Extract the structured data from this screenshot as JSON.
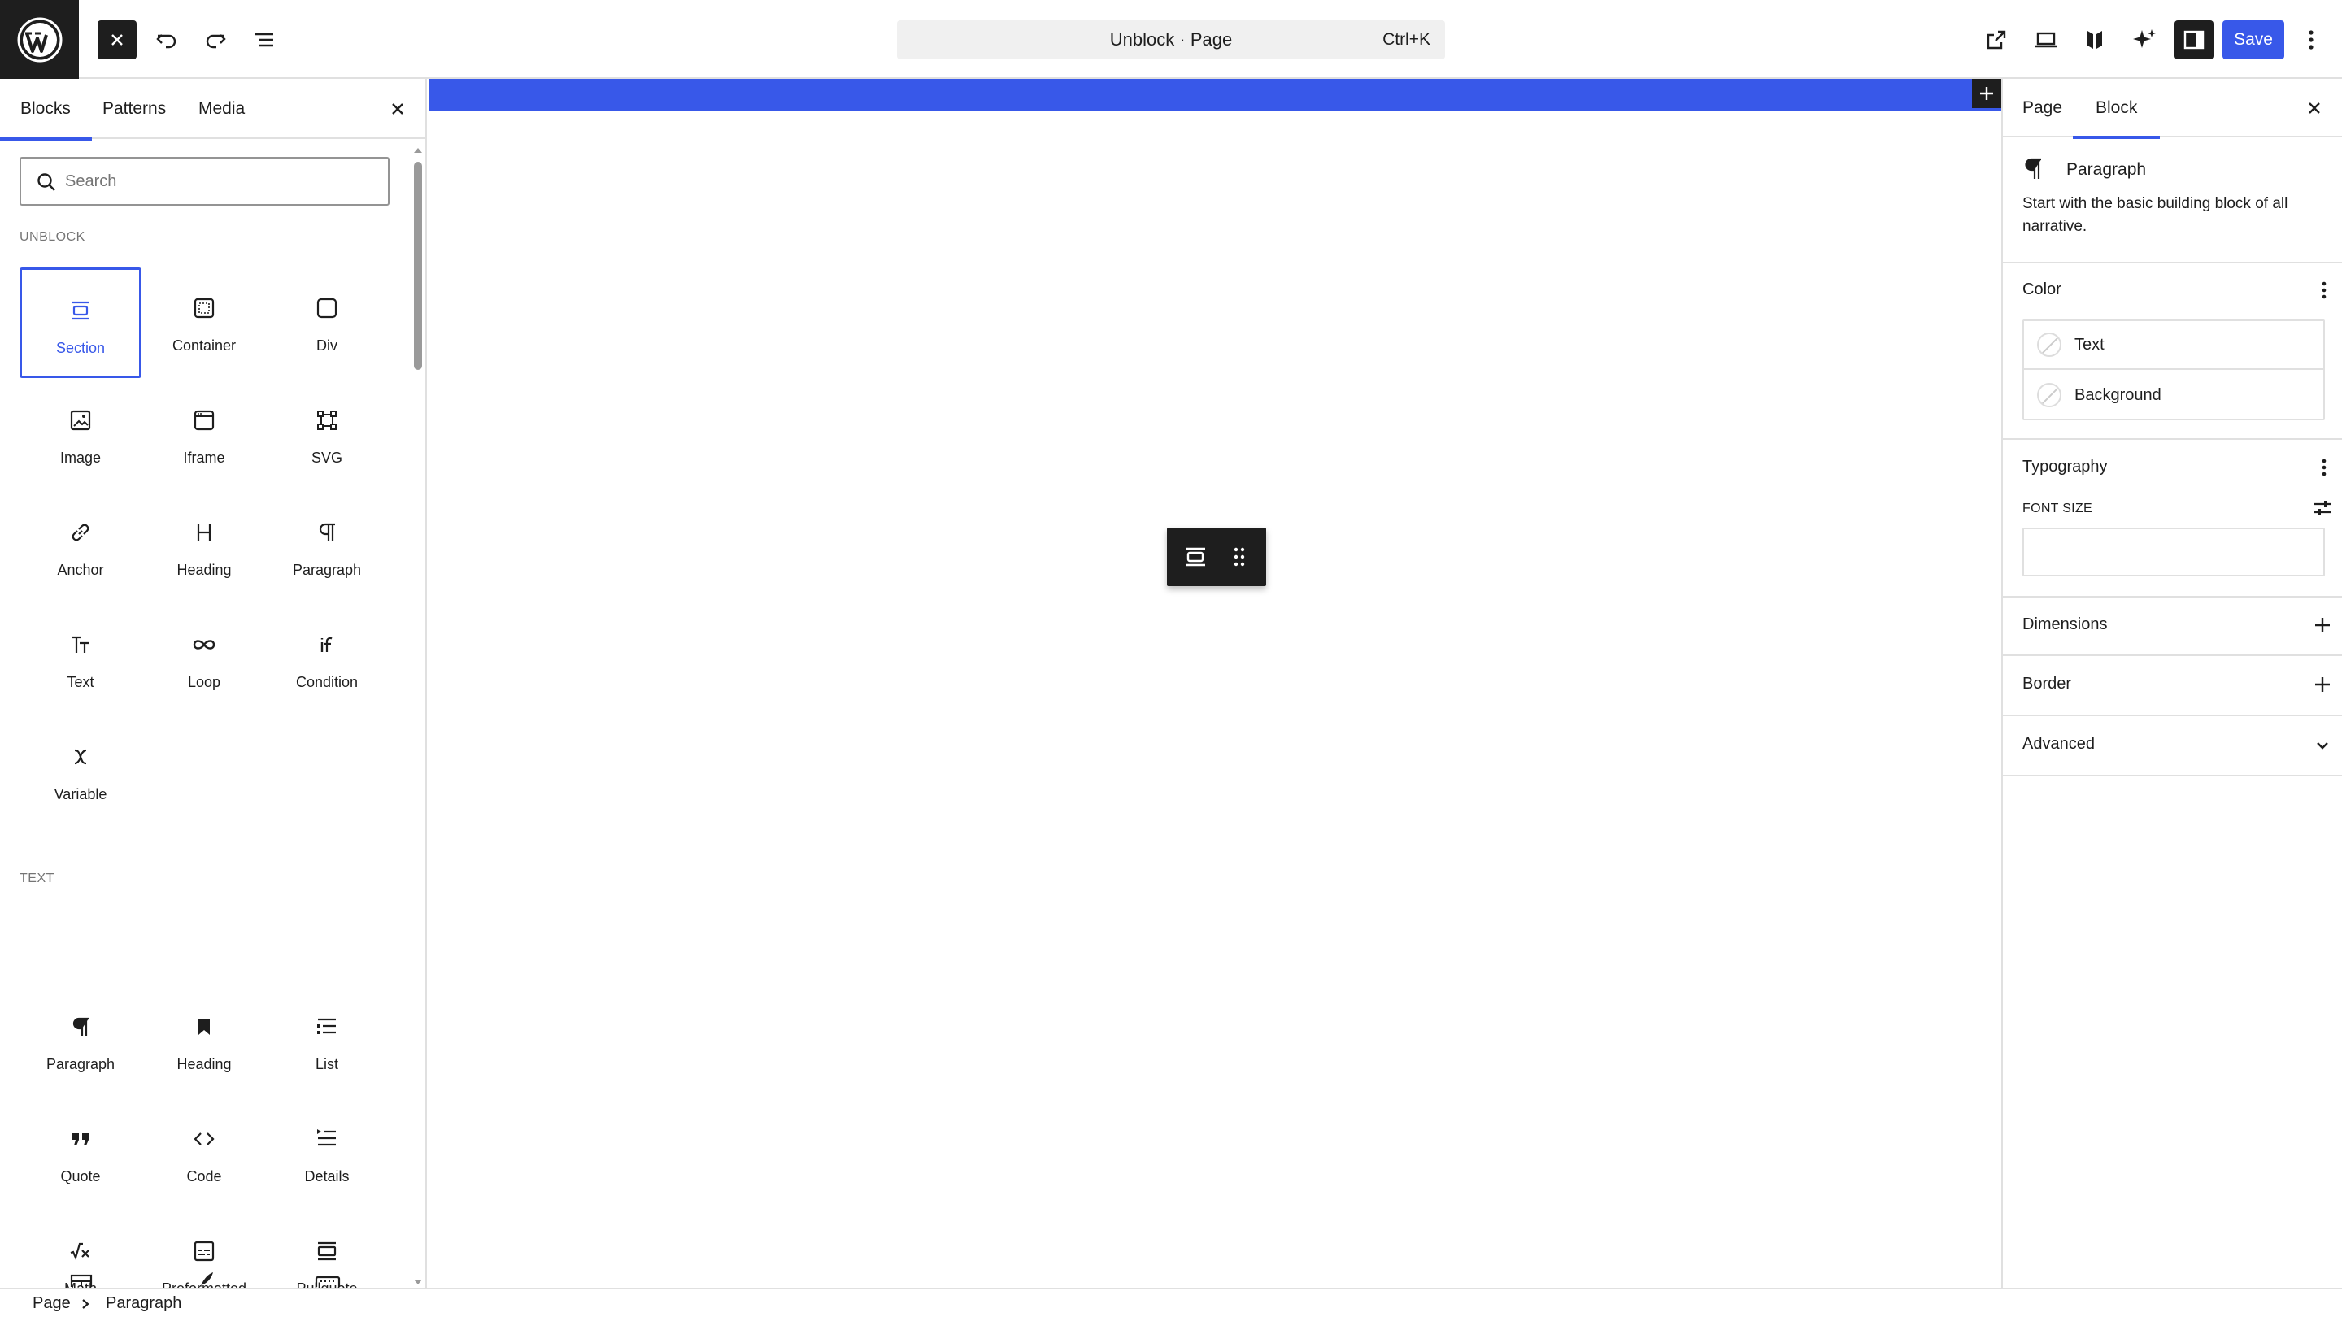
{
  "topbar": {
    "document_title": "Unblock · Page",
    "shortcut": "Ctrl+K",
    "save_label": "Save"
  },
  "left_panel": {
    "tabs": [
      {
        "label": "Blocks",
        "active": true
      },
      {
        "label": "Patterns",
        "active": false
      },
      {
        "label": "Media",
        "active": false
      }
    ],
    "search_placeholder": "Search",
    "categories": [
      {
        "label": "UNBLOCK",
        "blocks": [
          {
            "label": "Section",
            "icon": "section-icon",
            "selected": true
          },
          {
            "label": "Container",
            "icon": "container-icon"
          },
          {
            "label": "Div",
            "icon": "div-icon"
          },
          {
            "label": "Image",
            "icon": "image-icon"
          },
          {
            "label": "Iframe",
            "icon": "iframe-icon"
          },
          {
            "label": "SVG",
            "icon": "svg-icon"
          },
          {
            "label": "Anchor",
            "icon": "link-icon"
          },
          {
            "label": "Heading",
            "icon": "heading-icon"
          },
          {
            "label": "Paragraph",
            "icon": "paragraph-icon"
          },
          {
            "label": "Text",
            "icon": "text-icon"
          },
          {
            "label": "Loop",
            "icon": "loop-icon"
          },
          {
            "label": "Condition",
            "icon": "condition-icon"
          },
          {
            "label": "Variable",
            "icon": "variable-icon"
          }
        ]
      },
      {
        "label": "TEXT",
        "blocks": [
          {
            "label": "Paragraph",
            "icon": "paragraph-icon"
          },
          {
            "label": "Heading",
            "icon": "bookmark-icon"
          },
          {
            "label": "List",
            "icon": "list-icon"
          },
          {
            "label": "Quote",
            "icon": "quote-icon"
          },
          {
            "label": "Code",
            "icon": "code-icon"
          },
          {
            "label": "Details",
            "icon": "details-icon"
          },
          {
            "label": "Math",
            "icon": "math-icon"
          },
          {
            "label": "Preformatted",
            "icon": "preformatted-icon"
          },
          {
            "label": "Pullquote",
            "icon": "pullquote-icon"
          }
        ]
      }
    ]
  },
  "right_panel": {
    "tabs": [
      {
        "label": "Page",
        "active": false
      },
      {
        "label": "Block",
        "active": true
      }
    ],
    "block_card": {
      "title": "Paragraph",
      "description": "Start with the basic building block of all narrative."
    },
    "color": {
      "title": "Color",
      "items": [
        "Text",
        "Background"
      ]
    },
    "typography": {
      "title": "Typography",
      "font_size_label": "FONT SIZE"
    },
    "dimensions": {
      "title": "Dimensions"
    },
    "border": {
      "title": "Border"
    },
    "advanced": {
      "title": "Advanced"
    }
  },
  "breadcrumb": [
    "Page",
    "Paragraph"
  ],
  "colors": {
    "accent": "#3858e9",
    "dark": "#1e1e1e",
    "border": "#e0e0e0"
  }
}
